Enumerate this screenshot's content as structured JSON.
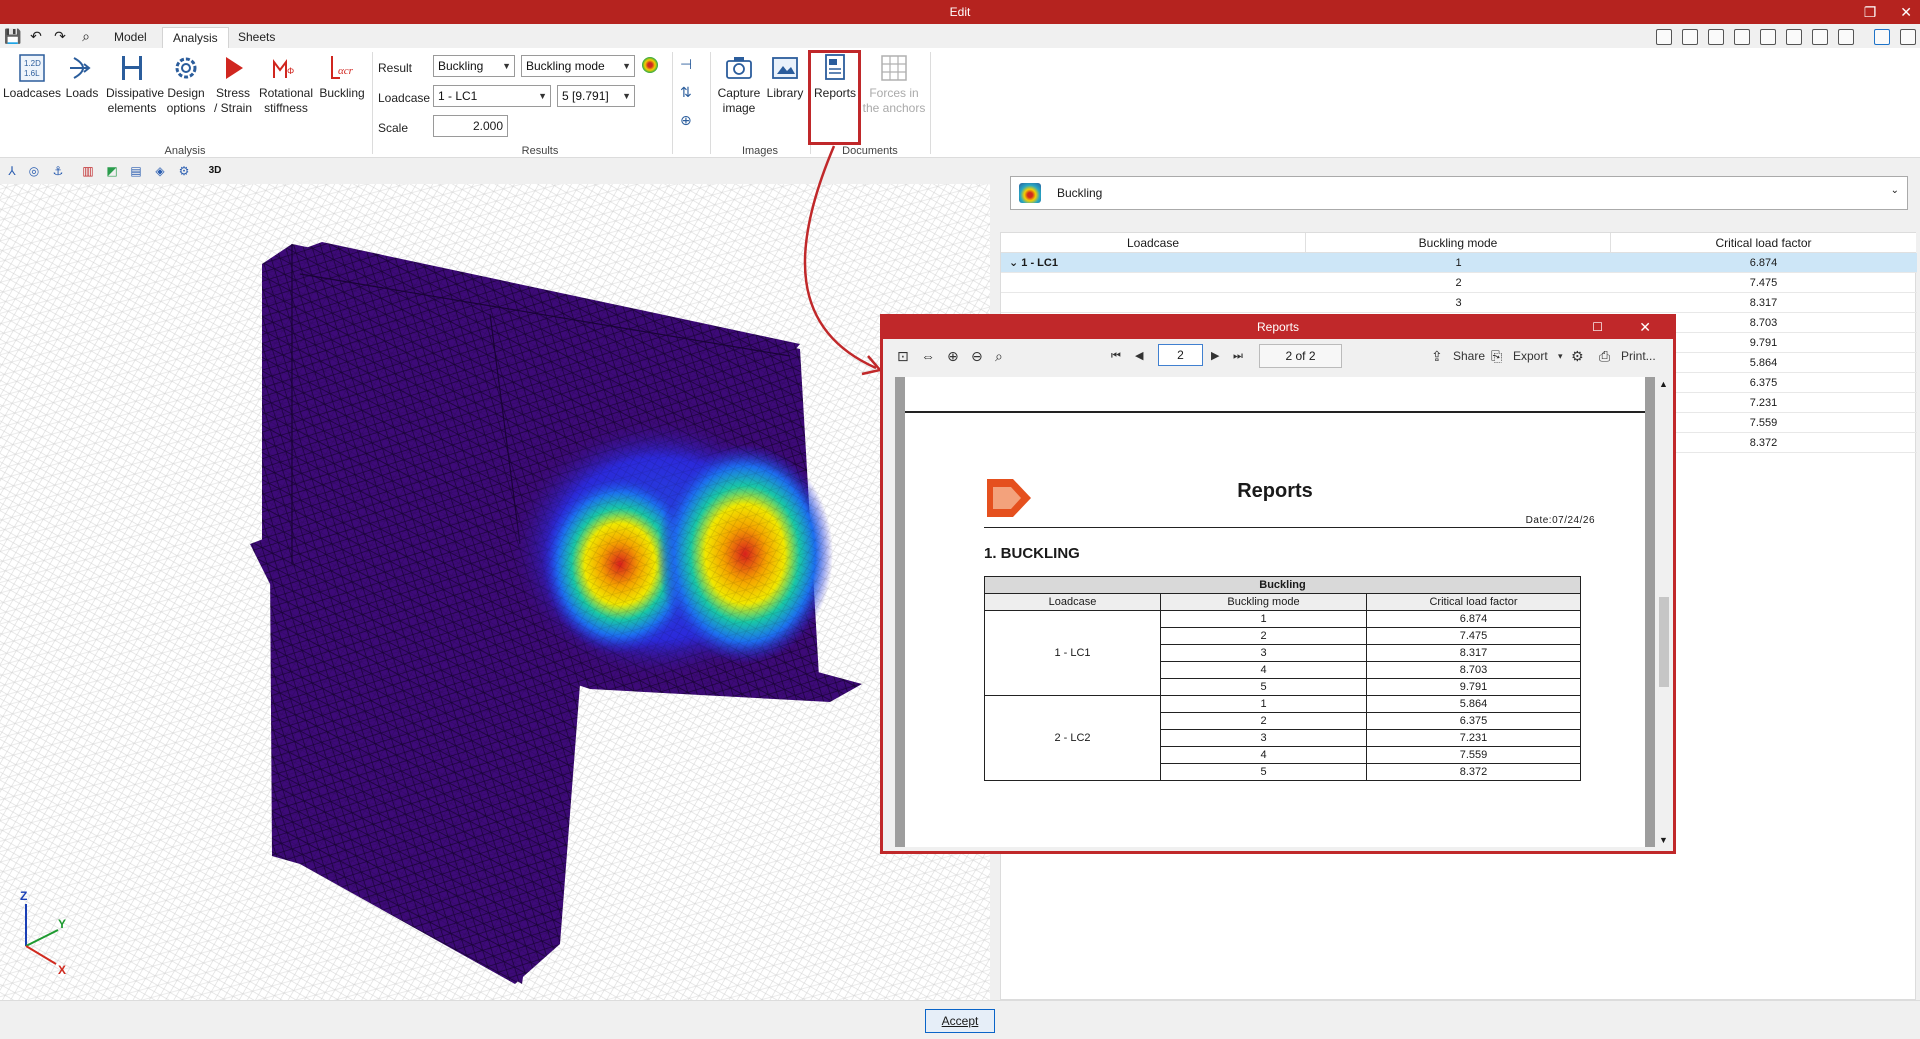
{
  "window": {
    "title": "Edit"
  },
  "menu": {
    "tabs": [
      "Model",
      "Analysis",
      "Sheets"
    ],
    "active_tab": "Analysis"
  },
  "ribbon": {
    "analysis_group": {
      "label": "Analysis",
      "buttons": [
        {
          "label": "Loadcases",
          "icon": "loadcases-icon"
        },
        {
          "label": "Loads",
          "icon": "loads-icon"
        },
        {
          "label": "Dissipative elements",
          "icon": "dissipative-icon"
        },
        {
          "label": "Design options",
          "icon": "gear-icon"
        },
        {
          "label": "Stress / Strain",
          "icon": "play-icon"
        },
        {
          "label": "Rotational stiffness",
          "icon": "stiffness-icon"
        },
        {
          "label": "Buckling",
          "icon": "buckling-icon"
        }
      ]
    },
    "results_group": {
      "label": "Results",
      "result_label": "Result",
      "result_value": "Buckling",
      "mode_value": "Buckling mode",
      "loadcase_label": "Loadcase",
      "loadcase_value": "1 - LC1",
      "mode_select_value": "5 [9.791]",
      "scale_label": "Scale",
      "scale_value": "2.000"
    },
    "images_group": {
      "label": "Images",
      "buttons": [
        {
          "label": "Capture image",
          "icon": "camera-icon"
        },
        {
          "label": "Library",
          "icon": "library-icon"
        }
      ]
    },
    "documents_group": {
      "label": "Documents",
      "buttons": [
        {
          "label": "Reports",
          "icon": "reports-icon"
        },
        {
          "label": "Forces in the anchors",
          "icon": "anchors-icon",
          "disabled": true
        }
      ]
    }
  },
  "viewport": {
    "axes": {
      "z": "Z",
      "y": "Y",
      "x": "X"
    },
    "toolbar_badge": "3D"
  },
  "result_panel": {
    "selector_value": "Buckling",
    "table": {
      "columns": [
        "Loadcase",
        "Buckling mode",
        "Critical load factor"
      ],
      "group": "1 - LC1",
      "rows": [
        {
          "mode": "1",
          "factor": "6.874"
        },
        {
          "mode": "2",
          "factor": "7.475"
        },
        {
          "mode": "3",
          "factor": "8.317"
        },
        {
          "mode": "",
          "factor": "8.703"
        },
        {
          "mode": "",
          "factor": "9.791"
        },
        {
          "mode": "",
          "factor": "5.864"
        },
        {
          "mode": "",
          "factor": "6.375"
        },
        {
          "mode": "",
          "factor": "7.231"
        },
        {
          "mode": "",
          "factor": "7.559"
        },
        {
          "mode": "",
          "factor": "8.372"
        }
      ]
    }
  },
  "dialog": {
    "title": "Reports",
    "page_input": "2",
    "page_count": "2 of 2",
    "share_label": "Share",
    "export_label": "Export",
    "print_label": "Print...",
    "report": {
      "heading": "Reports",
      "date": "Date:07/24/26",
      "section": "1. BUCKLING",
      "table_caption": "Buckling",
      "columns": [
        "Loadcase",
        "Buckling mode",
        "Critical load factor"
      ],
      "groups": [
        {
          "loadcase": "1 - LC1",
          "rows": [
            [
              "1",
              "6.874"
            ],
            [
              "2",
              "7.475"
            ],
            [
              "3",
              "8.317"
            ],
            [
              "4",
              "8.703"
            ],
            [
              "5",
              "9.791"
            ]
          ]
        },
        {
          "loadcase": "2 - LC2",
          "rows": [
            [
              "1",
              "5.864"
            ],
            [
              "2",
              "6.375"
            ],
            [
              "3",
              "7.231"
            ],
            [
              "4",
              "7.559"
            ],
            [
              "5",
              "8.372"
            ]
          ]
        }
      ]
    }
  },
  "footer": {
    "accept_label": "Accept"
  },
  "colors": {
    "brand_red": "#b5231f",
    "highlight": "#c0282a",
    "mesh": "#3d0a78"
  }
}
